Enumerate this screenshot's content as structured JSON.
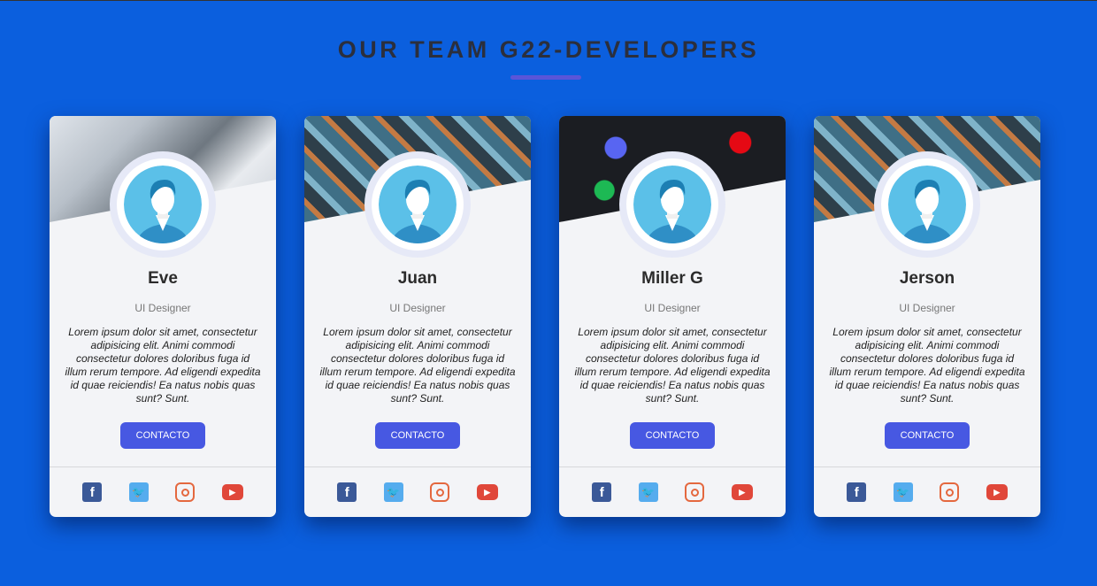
{
  "header": {
    "title": "OUR TEAM G22-DEVELOPERS"
  },
  "members": [
    {
      "name": "Eve",
      "role": "UI Designer",
      "description": "Lorem ipsum dolor sit amet, consectetur adipisicing elit. Animi commodi consectetur dolores doloribus fuga id illum rerum tempore. Ad eligendi expedita id quae reiciendis! Ea natus nobis quas sunt? Sunt.",
      "button": "CONTACTO"
    },
    {
      "name": "Juan",
      "role": "UI Designer",
      "description": "Lorem ipsum dolor sit amet, consectetur adipisicing elit. Animi commodi consectetur dolores doloribus fuga id illum rerum tempore. Ad eligendi expedita id quae reiciendis! Ea natus nobis quas sunt? Sunt.",
      "button": "CONTACTO"
    },
    {
      "name": "Miller G",
      "role": "UI Designer",
      "description": "Lorem ipsum dolor sit amet, consectetur adipisicing elit. Animi commodi consectetur dolores doloribus fuga id illum rerum tempore. Ad eligendi expedita id quae reiciendis! Ea natus nobis quas sunt? Sunt.",
      "button": "CONTACTO"
    },
    {
      "name": "Jerson",
      "role": "UI Designer",
      "description": "Lorem ipsum dolor sit amet, consectetur adipisicing elit. Animi commodi consectetur dolores doloribus fuga id illum rerum tempore. Ad eligendi expedita id quae reiciendis! Ea natus nobis quas sunt? Sunt.",
      "button": "CONTACTO"
    }
  ],
  "social_icons": [
    "facebook-icon",
    "twitter-icon",
    "instagram-icon",
    "youtube-icon"
  ],
  "colors": {
    "background": "#0b5fde",
    "accent": "#4758e2",
    "facebook": "#3b5998",
    "twitter": "#55acee",
    "instagram": "#e4683f",
    "youtube": "#e0473a"
  }
}
